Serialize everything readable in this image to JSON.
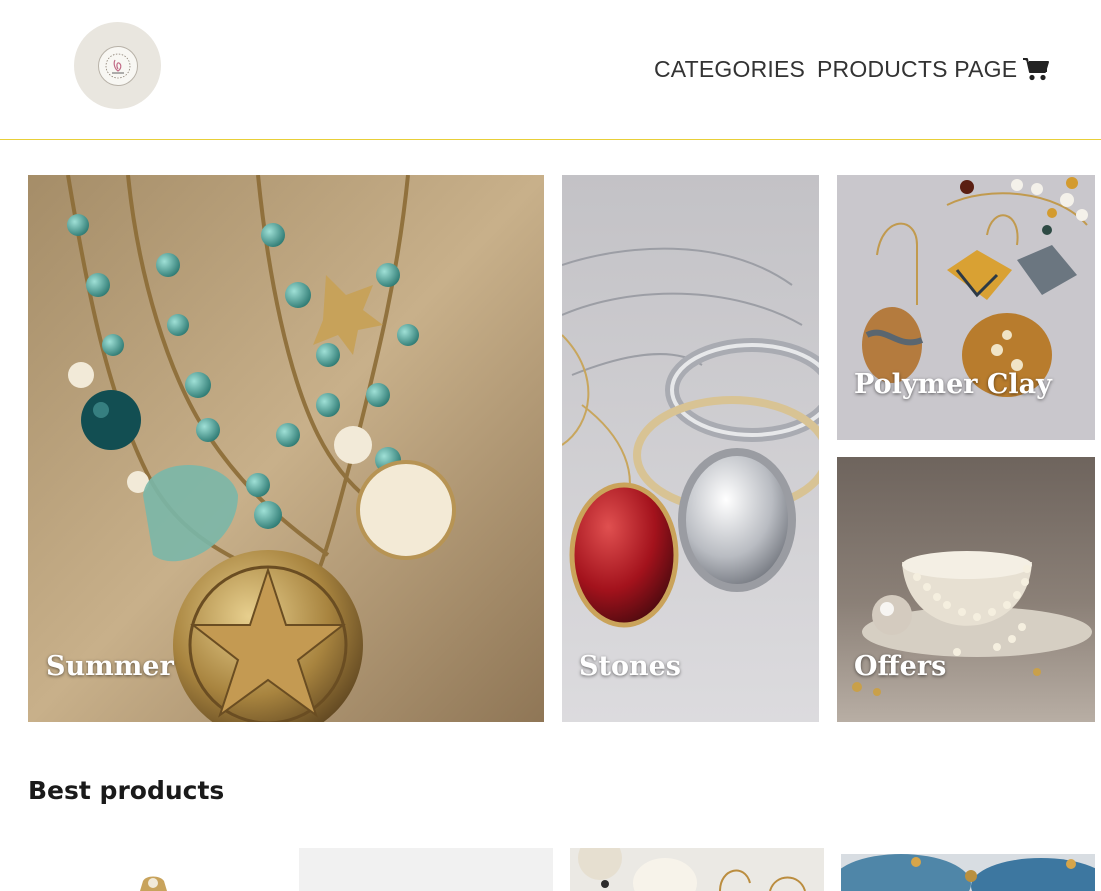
{
  "header": {
    "nav": {
      "categories": "CATEGORIES",
      "products_page": "PRODUCTS PAGE"
    },
    "cart_icon": "shopping-cart-icon",
    "accent_color": "#e8cf39"
  },
  "tiles": {
    "summer": {
      "label": "Summer"
    },
    "stones": {
      "label": "Stones"
    },
    "polymer": {
      "label": "Polymer Clay"
    },
    "offers": {
      "label": "Offers"
    }
  },
  "best_products": {
    "title": "Best products"
  }
}
